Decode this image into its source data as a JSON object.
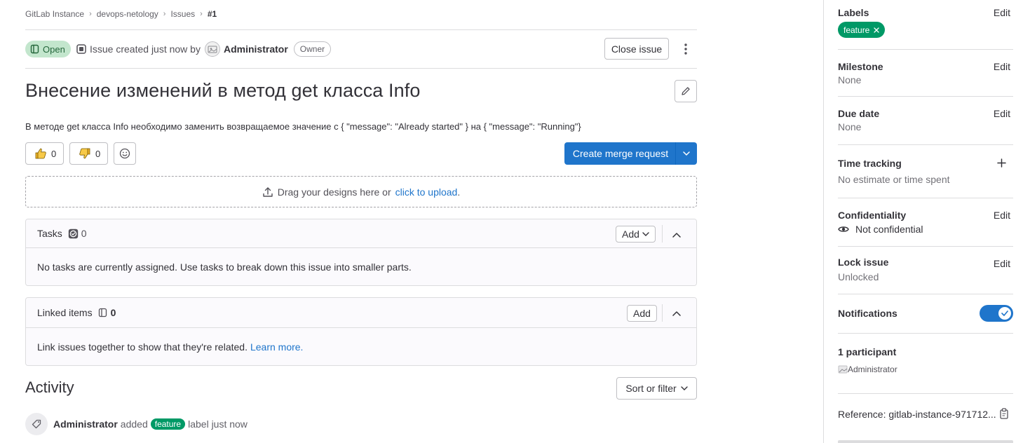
{
  "breadcrumb": {
    "items": [
      "GitLab Instance",
      "devops-netology",
      "Issues"
    ],
    "current": "#1"
  },
  "issue": {
    "status": "Open",
    "created_text": "Issue created just now by",
    "author": "Administrator",
    "author_role": "Owner",
    "close_label": "Close issue",
    "title": "Внесение изменений в метод get класса Info",
    "description": "В методе get класса Info необходимо заменить возвращаемое значение с { \"message\": \"Already started\" } на { \"message\": \"Running\"}"
  },
  "awards": {
    "thumbsup_count": "0",
    "thumbsdown_count": "0"
  },
  "merge_request": {
    "label": "Create merge request"
  },
  "dropzone": {
    "text": "Drag your designs here or",
    "link": "click to upload",
    "suffix": "."
  },
  "tasks": {
    "title": "Tasks",
    "count": "0",
    "add_label": "Add",
    "empty_text": "No tasks are currently assigned. Use tasks to break down this issue into smaller parts."
  },
  "linked": {
    "title": "Linked items",
    "count": "0",
    "add_label": "Add",
    "empty_text": "Link issues together to show that they're related.",
    "learn_more": "Learn more."
  },
  "activity": {
    "title": "Activity",
    "sort_label": "Sort or filter",
    "item": {
      "author": "Administrator",
      "action": "added",
      "label": "feature",
      "suffix": "label just now"
    }
  },
  "sidebar": {
    "edit_label": "Edit",
    "labels": {
      "title": "Labels",
      "chip": "feature"
    },
    "milestone": {
      "title": "Milestone",
      "value": "None"
    },
    "due_date": {
      "title": "Due date",
      "value": "None"
    },
    "time_tracking": {
      "title": "Time tracking",
      "value": "No estimate or time spent"
    },
    "confidentiality": {
      "title": "Confidentiality",
      "value": "Not confidential"
    },
    "lock": {
      "title": "Lock issue",
      "value": "Unlocked"
    },
    "notifications": {
      "title": "Notifications",
      "enabled": true
    },
    "participants": {
      "title": "1 participant",
      "name": "Administrator"
    },
    "reference": {
      "text": "Reference: gitlab-instance-971712..."
    }
  },
  "colors": {
    "primary": "#1f75cb",
    "label_green": "#009966",
    "open_badge_bg": "#c3e6cd",
    "open_badge_text": "#24663b"
  },
  "icons": [
    "chevron-right-icon",
    "issue-open-icon",
    "issue-type-icon",
    "kebab-icon",
    "pencil-icon",
    "thumbsup-icon",
    "thumbsdown-icon",
    "smiley-icon",
    "chevron-down-icon",
    "upload-icon",
    "task-done-icon",
    "chevron-up-icon",
    "issues-icon",
    "label-icon",
    "plus-icon",
    "eye-icon",
    "check-icon",
    "copy-icon",
    "remove-icon"
  ]
}
